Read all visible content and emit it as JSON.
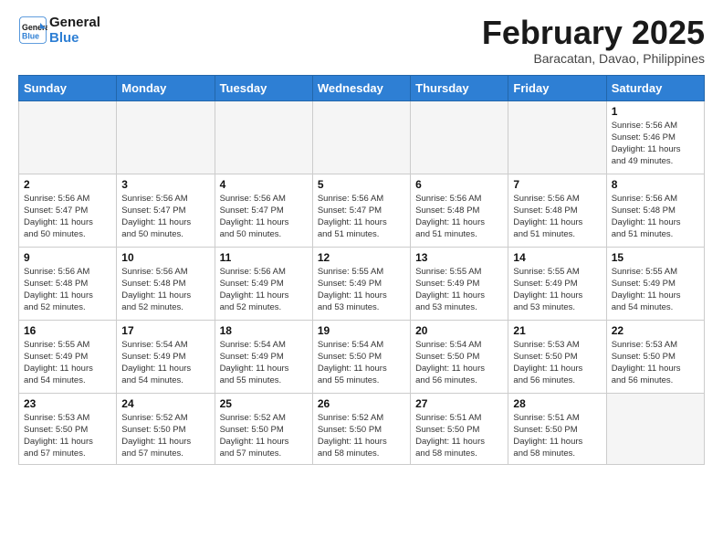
{
  "header": {
    "logo_line1": "General",
    "logo_line2": "Blue",
    "month_title": "February 2025",
    "location": "Baracatan, Davao, Philippines"
  },
  "weekdays": [
    "Sunday",
    "Monday",
    "Tuesday",
    "Wednesday",
    "Thursday",
    "Friday",
    "Saturday"
  ],
  "weeks": [
    [
      {
        "day": "",
        "info": ""
      },
      {
        "day": "",
        "info": ""
      },
      {
        "day": "",
        "info": ""
      },
      {
        "day": "",
        "info": ""
      },
      {
        "day": "",
        "info": ""
      },
      {
        "day": "",
        "info": ""
      },
      {
        "day": "1",
        "info": "Sunrise: 5:56 AM\nSunset: 5:46 PM\nDaylight: 11 hours\nand 49 minutes."
      }
    ],
    [
      {
        "day": "2",
        "info": "Sunrise: 5:56 AM\nSunset: 5:47 PM\nDaylight: 11 hours\nand 50 minutes."
      },
      {
        "day": "3",
        "info": "Sunrise: 5:56 AM\nSunset: 5:47 PM\nDaylight: 11 hours\nand 50 minutes."
      },
      {
        "day": "4",
        "info": "Sunrise: 5:56 AM\nSunset: 5:47 PM\nDaylight: 11 hours\nand 50 minutes."
      },
      {
        "day": "5",
        "info": "Sunrise: 5:56 AM\nSunset: 5:47 PM\nDaylight: 11 hours\nand 51 minutes."
      },
      {
        "day": "6",
        "info": "Sunrise: 5:56 AM\nSunset: 5:48 PM\nDaylight: 11 hours\nand 51 minutes."
      },
      {
        "day": "7",
        "info": "Sunrise: 5:56 AM\nSunset: 5:48 PM\nDaylight: 11 hours\nand 51 minutes."
      },
      {
        "day": "8",
        "info": "Sunrise: 5:56 AM\nSunset: 5:48 PM\nDaylight: 11 hours\nand 51 minutes."
      }
    ],
    [
      {
        "day": "9",
        "info": "Sunrise: 5:56 AM\nSunset: 5:48 PM\nDaylight: 11 hours\nand 52 minutes."
      },
      {
        "day": "10",
        "info": "Sunrise: 5:56 AM\nSunset: 5:48 PM\nDaylight: 11 hours\nand 52 minutes."
      },
      {
        "day": "11",
        "info": "Sunrise: 5:56 AM\nSunset: 5:49 PM\nDaylight: 11 hours\nand 52 minutes."
      },
      {
        "day": "12",
        "info": "Sunrise: 5:55 AM\nSunset: 5:49 PM\nDaylight: 11 hours\nand 53 minutes."
      },
      {
        "day": "13",
        "info": "Sunrise: 5:55 AM\nSunset: 5:49 PM\nDaylight: 11 hours\nand 53 minutes."
      },
      {
        "day": "14",
        "info": "Sunrise: 5:55 AM\nSunset: 5:49 PM\nDaylight: 11 hours\nand 53 minutes."
      },
      {
        "day": "15",
        "info": "Sunrise: 5:55 AM\nSunset: 5:49 PM\nDaylight: 11 hours\nand 54 minutes."
      }
    ],
    [
      {
        "day": "16",
        "info": "Sunrise: 5:55 AM\nSunset: 5:49 PM\nDaylight: 11 hours\nand 54 minutes."
      },
      {
        "day": "17",
        "info": "Sunrise: 5:54 AM\nSunset: 5:49 PM\nDaylight: 11 hours\nand 54 minutes."
      },
      {
        "day": "18",
        "info": "Sunrise: 5:54 AM\nSunset: 5:49 PM\nDaylight: 11 hours\nand 55 minutes."
      },
      {
        "day": "19",
        "info": "Sunrise: 5:54 AM\nSunset: 5:50 PM\nDaylight: 11 hours\nand 55 minutes."
      },
      {
        "day": "20",
        "info": "Sunrise: 5:54 AM\nSunset: 5:50 PM\nDaylight: 11 hours\nand 56 minutes."
      },
      {
        "day": "21",
        "info": "Sunrise: 5:53 AM\nSunset: 5:50 PM\nDaylight: 11 hours\nand 56 minutes."
      },
      {
        "day": "22",
        "info": "Sunrise: 5:53 AM\nSunset: 5:50 PM\nDaylight: 11 hours\nand 56 minutes."
      }
    ],
    [
      {
        "day": "23",
        "info": "Sunrise: 5:53 AM\nSunset: 5:50 PM\nDaylight: 11 hours\nand 57 minutes."
      },
      {
        "day": "24",
        "info": "Sunrise: 5:52 AM\nSunset: 5:50 PM\nDaylight: 11 hours\nand 57 minutes."
      },
      {
        "day": "25",
        "info": "Sunrise: 5:52 AM\nSunset: 5:50 PM\nDaylight: 11 hours\nand 57 minutes."
      },
      {
        "day": "26",
        "info": "Sunrise: 5:52 AM\nSunset: 5:50 PM\nDaylight: 11 hours\nand 58 minutes."
      },
      {
        "day": "27",
        "info": "Sunrise: 5:51 AM\nSunset: 5:50 PM\nDaylight: 11 hours\nand 58 minutes."
      },
      {
        "day": "28",
        "info": "Sunrise: 5:51 AM\nSunset: 5:50 PM\nDaylight: 11 hours\nand 58 minutes."
      },
      {
        "day": "",
        "info": ""
      }
    ]
  ]
}
